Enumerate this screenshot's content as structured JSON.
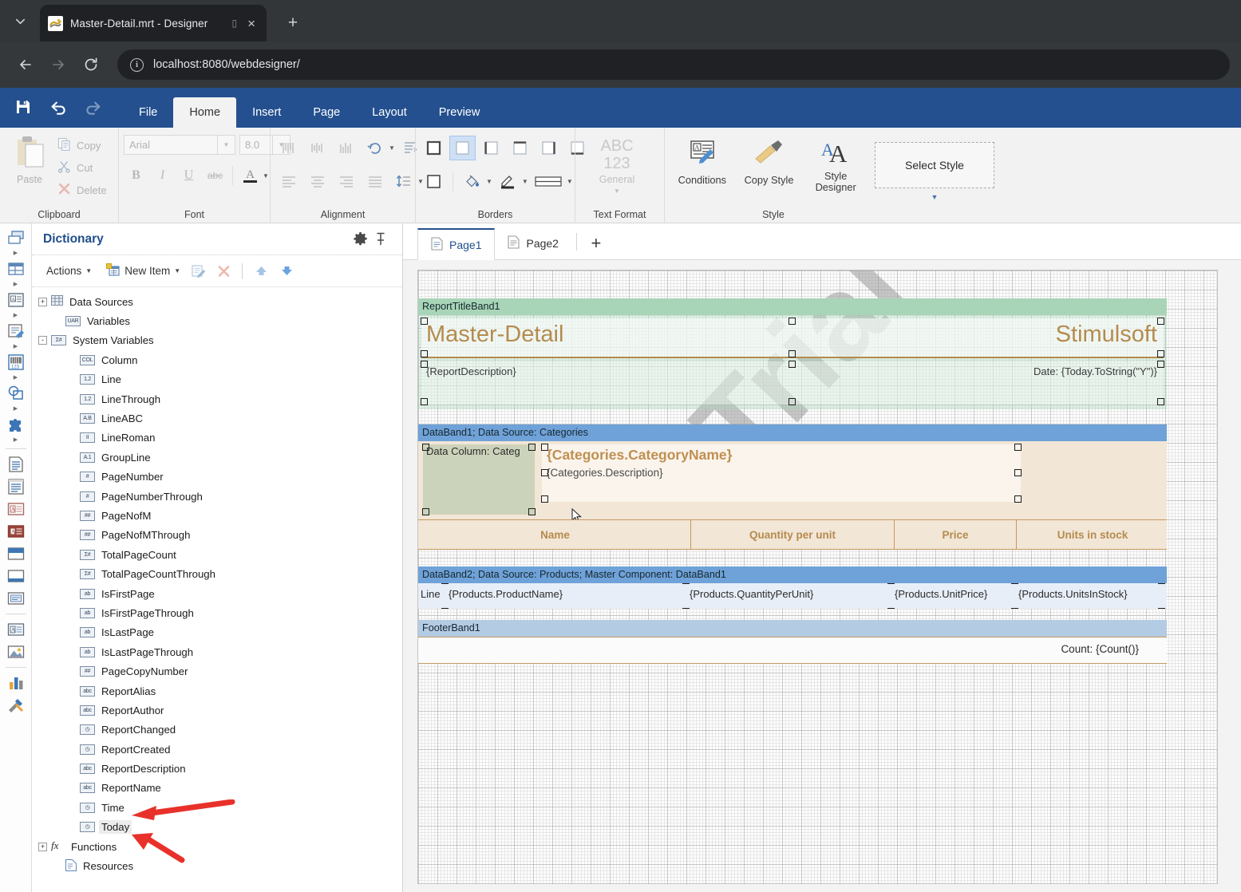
{
  "browser": {
    "tab_title": "Master-Detail.mrt - Designer",
    "tab_list_icon": "chevron-down-icon",
    "close_icon": "×",
    "new_tab_icon": "+",
    "back_icon": "←",
    "forward_icon": "→",
    "reload_icon": "⟳",
    "info_icon": "i",
    "url": "localhost:8080/webdesigner/"
  },
  "ribbon": {
    "quick_access": [
      {
        "name": "save",
        "icon": "save-icon"
      },
      {
        "name": "undo",
        "icon": "undo-icon"
      },
      {
        "name": "redo",
        "icon": "redo-icon"
      }
    ],
    "tabs": [
      {
        "label": "File",
        "active": false
      },
      {
        "label": "Home",
        "active": true
      },
      {
        "label": "Insert",
        "active": false
      },
      {
        "label": "Page",
        "active": false
      },
      {
        "label": "Layout",
        "active": false
      },
      {
        "label": "Preview",
        "active": false
      }
    ],
    "groups": {
      "clipboard": {
        "label": "Clipboard",
        "paste": "Paste",
        "items": [
          {
            "label": "Copy",
            "icon": "copy-icon"
          },
          {
            "label": "Cut",
            "icon": "scissors-icon"
          },
          {
            "label": "Delete",
            "icon": "delete-x-icon"
          }
        ]
      },
      "font": {
        "label": "Font",
        "font_name": "Arial",
        "font_size": "8.0",
        "bold": "B",
        "italic": "I",
        "underline": "U",
        "strikethrough": "abc",
        "text_color": "A"
      },
      "alignment": {
        "label": "Alignment"
      },
      "borders": {
        "label": "Borders"
      },
      "text_format": {
        "label": "Text Format",
        "abc": "ABC",
        "num": "123",
        "general": "General"
      },
      "style": {
        "label": "Style",
        "conditions": "Conditions",
        "copy_style": "Copy Style",
        "style_designer": "Style\nDesigner",
        "style_designer_line1": "Style",
        "style_designer_line2": "Designer",
        "select_style": "Select Style"
      }
    }
  },
  "dictionary": {
    "title": "Dictionary",
    "gear_icon": "gear-icon",
    "pin_icon": "pin-icon",
    "actions": {
      "actions_label": "Actions",
      "new_item_label": "New Item",
      "edit_icon": "edit-icon",
      "delete_icon": "delete-icon",
      "move_up_icon": "arrow-up-icon",
      "move_down_icon": "arrow-down-icon"
    },
    "tree": [
      {
        "label": "Data Sources",
        "icon": "table-icon",
        "badge": "",
        "expander": "+",
        "indent": 0,
        "selected": false
      },
      {
        "label": "Variables",
        "icon": "var-icon",
        "badge": "UAR",
        "expander": "",
        "indent": 1,
        "selected": false
      },
      {
        "label": "System Variables",
        "icon": "sysvar-icon",
        "badge": "Σ#",
        "expander": "-",
        "indent": 0,
        "selected": false
      },
      {
        "label": "Column",
        "icon": "col-icon",
        "badge": "COL",
        "expander": "",
        "indent": 2,
        "selected": false
      },
      {
        "label": "Line",
        "icon": "num-icon",
        "badge": "1.2",
        "expander": "",
        "indent": 2,
        "selected": false
      },
      {
        "label": "LineThrough",
        "icon": "num-icon",
        "badge": "1.2",
        "expander": "",
        "indent": 2,
        "selected": false
      },
      {
        "label": "LineABC",
        "icon": "abc-icon",
        "badge": "A.B",
        "expander": "",
        "indent": 2,
        "selected": false
      },
      {
        "label": "LineRoman",
        "icon": "roman-icon",
        "badge": "II",
        "expander": "",
        "indent": 2,
        "selected": false
      },
      {
        "label": "GroupLine",
        "icon": "group-icon",
        "badge": "A.1",
        "expander": "",
        "indent": 2,
        "selected": false
      },
      {
        "label": "PageNumber",
        "icon": "hash-icon",
        "badge": "#",
        "expander": "",
        "indent": 2,
        "selected": false
      },
      {
        "label": "PageNumberThrough",
        "icon": "hash-icon",
        "badge": "#",
        "expander": "",
        "indent": 2,
        "selected": false
      },
      {
        "label": "PageNofM",
        "icon": "hash2-icon",
        "badge": "##",
        "expander": "",
        "indent": 2,
        "selected": false
      },
      {
        "label": "PageNofMThrough",
        "icon": "hash2-icon",
        "badge": "##",
        "expander": "",
        "indent": 2,
        "selected": false
      },
      {
        "label": "TotalPageCount",
        "icon": "sum-icon",
        "badge": "Σ#",
        "expander": "",
        "indent": 2,
        "selected": false
      },
      {
        "label": "TotalPageCountThrough",
        "icon": "sum-icon",
        "badge": "Σ#",
        "expander": "",
        "indent": 2,
        "selected": false
      },
      {
        "label": "IsFirstPage",
        "icon": "bool-icon",
        "badge": "ab",
        "expander": "",
        "indent": 2,
        "selected": false
      },
      {
        "label": "IsFirstPageThrough",
        "icon": "bool-icon",
        "badge": "ab",
        "expander": "",
        "indent": 2,
        "selected": false
      },
      {
        "label": "IsLastPage",
        "icon": "bool-icon",
        "badge": "ab",
        "expander": "",
        "indent": 2,
        "selected": false
      },
      {
        "label": "IsLastPageThrough",
        "icon": "bool-icon",
        "badge": "ab",
        "expander": "",
        "indent": 2,
        "selected": false
      },
      {
        "label": "PageCopyNumber",
        "icon": "hash2-icon",
        "badge": "##",
        "expander": "",
        "indent": 2,
        "selected": false
      },
      {
        "label": "ReportAlias",
        "icon": "abc2-icon",
        "badge": "abc",
        "expander": "",
        "indent": 2,
        "selected": false
      },
      {
        "label": "ReportAuthor",
        "icon": "abc2-icon",
        "badge": "abc",
        "expander": "",
        "indent": 2,
        "selected": false
      },
      {
        "label": "ReportChanged",
        "icon": "clock-icon",
        "badge": "◷",
        "expander": "",
        "indent": 2,
        "selected": false
      },
      {
        "label": "ReportCreated",
        "icon": "clock-icon",
        "badge": "◷",
        "expander": "",
        "indent": 2,
        "selected": false
      },
      {
        "label": "ReportDescription",
        "icon": "abc2-icon",
        "badge": "abc",
        "expander": "",
        "indent": 2,
        "selected": false
      },
      {
        "label": "ReportName",
        "icon": "abc2-icon",
        "badge": "abc",
        "expander": "",
        "indent": 2,
        "selected": false
      },
      {
        "label": "Time",
        "icon": "clock-icon",
        "badge": "◷",
        "expander": "",
        "indent": 2,
        "selected": false
      },
      {
        "label": "Today",
        "icon": "clock-icon",
        "badge": "◷",
        "expander": "",
        "indent": 2,
        "selected": true
      },
      {
        "label": "Functions",
        "icon": "fx-icon",
        "badge": "",
        "expander": "+",
        "indent": 0,
        "selected": false
      },
      {
        "label": "Resources",
        "icon": "resource-icon",
        "badge": "",
        "expander": "",
        "indent": 1,
        "selected": false
      }
    ]
  },
  "design": {
    "page_tabs": [
      {
        "label": "Page1",
        "active": true
      },
      {
        "label": "Page2",
        "active": false
      }
    ],
    "add_page_icon": "+",
    "watermark": "Trial",
    "bands": {
      "report_title": {
        "header": "ReportTitleBand1",
        "title": "Master-Detail",
        "brand": "Stimulsoft",
        "description": "{ReportDescription}",
        "date": "Date: {Today.ToString(\"Y\")}"
      },
      "data_band1": {
        "header": "DataBand1; Data Source: Categories",
        "image_placeholder": "Data Column: Categ",
        "category_name": "{Categories.CategoryName}",
        "category_description": "{Categories.Description}"
      },
      "column_headers": [
        "Name",
        "Quantity per unit",
        "Price",
        "Units in stock"
      ],
      "data_band2": {
        "header": "DataBand2; Data Source: Products; Master Component: DataBand1",
        "line": "Line",
        "cells": [
          "{Products.ProductName}",
          "{Products.QuantityPerUnit}",
          "{Products.UnitPrice}",
          "{Products.UnitsInStock}"
        ]
      },
      "footer": {
        "header": "FooterBand1",
        "count": "Count: {Count()}"
      }
    }
  },
  "annotations": {
    "arrow_color": "#e8312a",
    "arrows": [
      {
        "name": "arrow-pointing-to-time",
        "target": "Time"
      },
      {
        "name": "arrow-pointing-to-today",
        "target": "Today"
      }
    ]
  },
  "colors": {
    "ribbon_blue": "#24508f",
    "title_band_green": "#a8d5b7",
    "data_band_blue": "#6fa2d8",
    "accent_gold": "#b58b4e",
    "panel_bg": "#f2f2f2"
  }
}
